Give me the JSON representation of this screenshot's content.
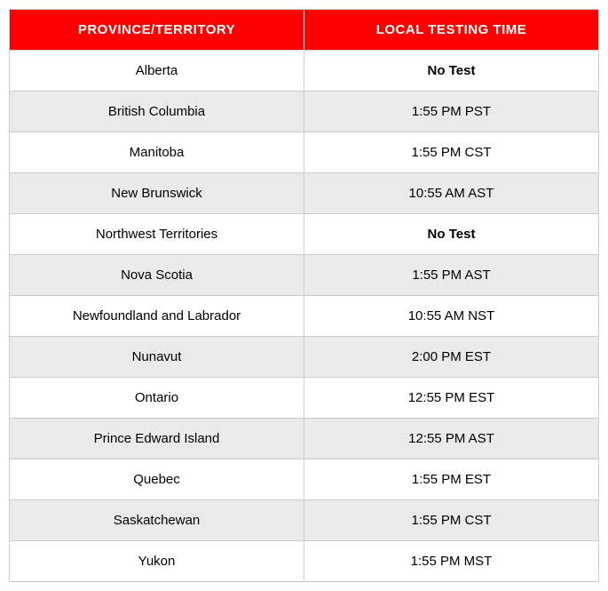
{
  "headers": {
    "col1": "Province/Territory",
    "col2": "Local Testing Time"
  },
  "rows": [
    {
      "province": "Alberta",
      "time": "No Test",
      "bold": true
    },
    {
      "province": "British Columbia",
      "time": "1:55 PM PST",
      "bold": false
    },
    {
      "province": "Manitoba",
      "time": "1:55 PM CST",
      "bold": false
    },
    {
      "province": "New Brunswick",
      "time": "10:55 AM AST",
      "bold": false
    },
    {
      "province": "Northwest Territories",
      "time": "No Test",
      "bold": true
    },
    {
      "province": "Nova Scotia",
      "time": "1:55 PM AST",
      "bold": false
    },
    {
      "province": "Newfoundland and Labrador",
      "time": "10:55 AM NST",
      "bold": false
    },
    {
      "province": "Nunavut",
      "time": "2:00 PM EST",
      "bold": false
    },
    {
      "province": "Ontario",
      "time": "12:55 PM EST",
      "bold": false
    },
    {
      "province": "Prince Edward Island",
      "time": "12:55 PM AST",
      "bold": false
    },
    {
      "province": "Quebec",
      "time": "1:55 PM EST",
      "bold": false
    },
    {
      "province": "Saskatchewan",
      "time": "1:55 PM CST",
      "bold": false
    },
    {
      "province": "Yukon",
      "time": "1:55 PM MST",
      "bold": false
    }
  ]
}
